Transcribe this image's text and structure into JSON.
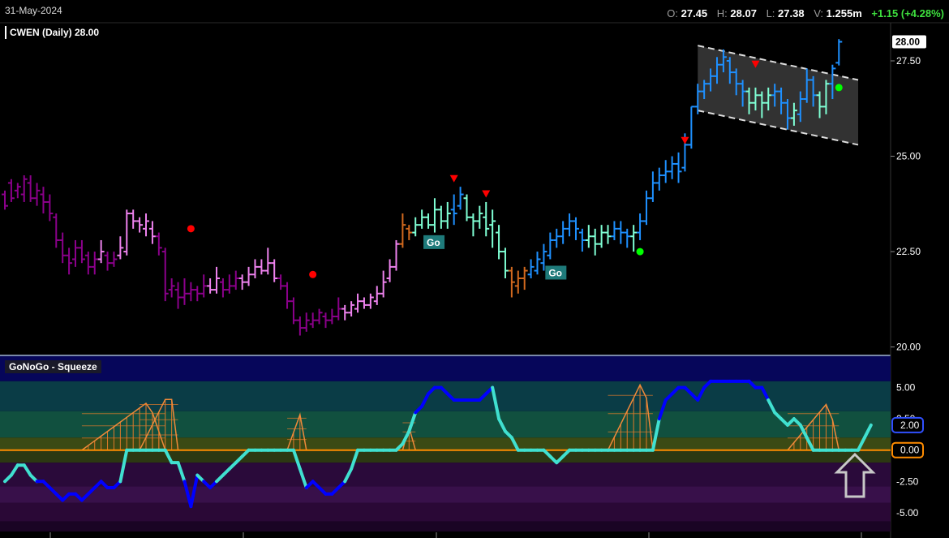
{
  "header": {
    "date": "31-May-2024",
    "open_key": "O:",
    "open": "27.45",
    "high_key": "H:",
    "high": "28.07",
    "low_key": "L:",
    "low": "27.38",
    "vol_key": "V:",
    "volume": "1.255m",
    "change": "+1.15 (+4.28%)"
  },
  "colors": {
    "background": "#000000",
    "go_strong": "#1e90ff",
    "go_weak": "#7fffd4",
    "nogo_strong": "#8b008b",
    "nogo_weak": "#ee82ee",
    "neutral": "#d2691e",
    "osc_low": "#0000ff",
    "osc_high": "#40e0d0",
    "zero_line": "#ff8c00",
    "up_marker": "#ff0000",
    "dn_marker": "#ff0000",
    "go_dot": "#00ff00",
    "nogo_dot": "#ff0000"
  },
  "chart_data": [
    {
      "type": "ohlc",
      "title": "CWEN (Daily) 28.00",
      "last_price_label": "28.00",
      "y_ticks": [
        "27.50",
        "25.00",
        "22.50",
        "20.00"
      ],
      "ylim": [
        19.8,
        28.5
      ],
      "channel_label": "",
      "go_labels": [
        "Go",
        "Go"
      ],
      "bars": [
        [
          0,
          24.0,
          23.7,
          24.1,
          23.6,
          "ns"
        ],
        [
          1,
          24.3,
          23.9,
          24.4,
          23.8,
          "ns"
        ],
        [
          2,
          24.1,
          24.2,
          24.3,
          23.9,
          "ns"
        ],
        [
          3,
          24.0,
          24.4,
          24.5,
          23.8,
          "ns"
        ],
        [
          4,
          24.3,
          23.9,
          24.5,
          23.8,
          "ns"
        ],
        [
          5,
          23.9,
          24.1,
          24.3,
          23.7,
          "ns"
        ],
        [
          6,
          24.0,
          23.8,
          24.2,
          23.5,
          "ns"
        ],
        [
          7,
          23.8,
          23.5,
          24.0,
          23.3,
          "ns"
        ],
        [
          8,
          23.4,
          22.8,
          23.5,
          22.6,
          "ns"
        ],
        [
          9,
          22.8,
          22.4,
          23.0,
          22.2,
          "ns"
        ],
        [
          10,
          22.4,
          22.2,
          22.6,
          21.9,
          "ns"
        ],
        [
          11,
          22.3,
          22.6,
          22.8,
          22.1,
          "ns"
        ],
        [
          12,
          22.6,
          22.3,
          22.8,
          22.2,
          "ns"
        ],
        [
          13,
          22.4,
          22.1,
          22.5,
          21.9,
          "ns"
        ],
        [
          14,
          22.1,
          22.3,
          22.5,
          21.9,
          "ns"
        ],
        [
          15,
          22.3,
          22.5,
          22.8,
          22.2,
          "nw"
        ],
        [
          16,
          22.4,
          22.2,
          22.5,
          22.0,
          "ns"
        ],
        [
          17,
          22.2,
          22.3,
          22.5,
          22.1,
          "ns"
        ],
        [
          18,
          22.4,
          22.6,
          22.9,
          22.3,
          "nw"
        ],
        [
          19,
          22.5,
          23.5,
          23.6,
          22.4,
          "nw"
        ],
        [
          20,
          23.5,
          23.3,
          23.6,
          23.1,
          "nw"
        ],
        [
          21,
          23.3,
          23.2,
          23.4,
          23.0,
          "nw"
        ],
        [
          22,
          23.1,
          23.3,
          23.5,
          22.9,
          "nw"
        ],
        [
          23,
          23.1,
          22.9,
          23.3,
          22.7,
          "nw"
        ],
        [
          24,
          22.9,
          22.6,
          23.0,
          22.4,
          "ns"
        ],
        [
          25,
          22.5,
          21.4,
          22.6,
          21.2,
          "ns"
        ],
        [
          26,
          21.5,
          21.6,
          21.8,
          21.3,
          "ns"
        ],
        [
          27,
          21.5,
          21.3,
          21.7,
          21.0,
          "ns"
        ],
        [
          28,
          21.3,
          21.4,
          21.8,
          21.1,
          "ns"
        ],
        [
          29,
          21.4,
          21.5,
          21.7,
          21.2,
          "ns"
        ],
        [
          30,
          21.5,
          21.4,
          21.6,
          21.2,
          "ns"
        ],
        [
          31,
          21.4,
          21.6,
          21.9,
          21.3,
          "ns"
        ],
        [
          32,
          21.6,
          21.5,
          21.8,
          21.4,
          "nw"
        ],
        [
          33,
          21.5,
          21.8,
          22.1,
          21.4,
          "nw"
        ],
        [
          34,
          21.7,
          21.5,
          21.8,
          21.3,
          "ns"
        ],
        [
          35,
          21.5,
          21.6,
          21.9,
          21.4,
          "ns"
        ],
        [
          36,
          21.6,
          21.8,
          22.0,
          21.5,
          "ns"
        ],
        [
          37,
          21.8,
          21.7,
          21.9,
          21.5,
          "nw"
        ],
        [
          38,
          21.7,
          21.9,
          22.1,
          21.6,
          "nw"
        ],
        [
          39,
          21.9,
          22.1,
          22.3,
          21.8,
          "nw"
        ],
        [
          40,
          22.1,
          22.0,
          22.3,
          21.9,
          "nw"
        ],
        [
          41,
          22.0,
          22.2,
          22.6,
          21.9,
          "nw"
        ],
        [
          42,
          22.2,
          21.8,
          22.3,
          21.7,
          "nw"
        ],
        [
          43,
          21.8,
          21.6,
          21.9,
          21.5,
          "ns"
        ],
        [
          44,
          21.6,
          21.2,
          21.7,
          21.0,
          "ns"
        ],
        [
          45,
          21.2,
          20.7,
          21.3,
          20.6,
          "ns"
        ],
        [
          46,
          20.7,
          20.5,
          20.8,
          20.3,
          "ns"
        ],
        [
          47,
          20.5,
          20.7,
          20.9,
          20.4,
          "ns"
        ],
        [
          48,
          20.6,
          20.7,
          20.9,
          20.5,
          "ns"
        ],
        [
          49,
          20.7,
          20.9,
          21.0,
          20.6,
          "ns"
        ],
        [
          50,
          20.8,
          20.7,
          20.9,
          20.5,
          "ns"
        ],
        [
          51,
          20.7,
          20.8,
          21.0,
          20.6,
          "ns"
        ],
        [
          52,
          20.8,
          21.0,
          21.3,
          20.7,
          "ns"
        ],
        [
          53,
          21.0,
          20.9,
          21.1,
          20.7,
          "nw"
        ],
        [
          54,
          20.9,
          21.1,
          21.2,
          20.8,
          "nw"
        ],
        [
          55,
          21.0,
          21.2,
          21.4,
          20.9,
          "nw"
        ],
        [
          56,
          21.2,
          21.1,
          21.3,
          21.0,
          "nw"
        ],
        [
          57,
          21.1,
          21.3,
          21.4,
          21.0,
          "nw"
        ],
        [
          58,
          21.2,
          21.4,
          21.6,
          21.1,
          "nw"
        ],
        [
          59,
          21.4,
          21.7,
          22.0,
          21.3,
          "nw"
        ],
        [
          60,
          21.8,
          22.1,
          22.3,
          21.7,
          "nw"
        ],
        [
          61,
          22.1,
          22.7,
          22.8,
          22.0,
          "nw"
        ],
        [
          62,
          22.7,
          23.2,
          23.5,
          22.6,
          "ne"
        ],
        [
          63,
          23.1,
          23.0,
          23.2,
          22.8,
          "ne"
        ],
        [
          64,
          23.0,
          23.2,
          23.4,
          22.9,
          "gw"
        ],
        [
          65,
          23.2,
          23.4,
          23.6,
          23.1,
          "gw"
        ],
        [
          66,
          23.4,
          23.2,
          23.5,
          23.1,
          "gw"
        ],
        [
          67,
          23.2,
          23.6,
          23.9,
          23.0,
          "gw"
        ],
        [
          68,
          23.6,
          23.3,
          23.7,
          23.1,
          "gw"
        ],
        [
          69,
          23.3,
          23.5,
          23.8,
          23.1,
          "gw"
        ],
        [
          70,
          23.6,
          23.5,
          24.0,
          23.2,
          "gs"
        ],
        [
          71,
          23.7,
          24.0,
          24.2,
          23.6,
          "gs"
        ],
        [
          72,
          23.9,
          23.4,
          24.0,
          23.3,
          "gw"
        ],
        [
          73,
          23.4,
          23.3,
          23.5,
          22.9,
          "gw"
        ],
        [
          74,
          23.3,
          23.5,
          23.7,
          23.1,
          "gw"
        ],
        [
          75,
          23.4,
          23.1,
          23.8,
          22.9,
          "gw"
        ],
        [
          76,
          23.2,
          23.3,
          23.6,
          22.6,
          "gw"
        ],
        [
          77,
          23.0,
          22.5,
          23.2,
          22.3,
          "gw"
        ],
        [
          78,
          22.5,
          22.0,
          22.6,
          21.8,
          "gw"
        ],
        [
          79,
          22.0,
          21.7,
          22.1,
          21.3,
          "ne"
        ],
        [
          80,
          21.6,
          21.8,
          22.0,
          21.4,
          "ne"
        ],
        [
          81,
          21.8,
          22.0,
          22.1,
          21.5,
          "ne"
        ],
        [
          82,
          21.9,
          22.1,
          22.3,
          21.8,
          "gs"
        ],
        [
          83,
          22.0,
          22.3,
          22.5,
          21.9,
          "gs"
        ],
        [
          84,
          22.2,
          22.5,
          22.7,
          22.0,
          "gs"
        ],
        [
          85,
          22.4,
          22.8,
          23.0,
          22.3,
          "gs"
        ],
        [
          86,
          22.8,
          22.9,
          23.1,
          22.6,
          "gs"
        ],
        [
          87,
          22.9,
          23.1,
          23.3,
          22.7,
          "gs"
        ],
        [
          88,
          23.1,
          23.3,
          23.5,
          22.9,
          "gs"
        ],
        [
          89,
          23.3,
          23.1,
          23.4,
          22.8,
          "gs"
        ],
        [
          90,
          23.0,
          22.8,
          23.1,
          22.5,
          "gs"
        ],
        [
          91,
          22.8,
          22.9,
          23.2,
          22.6,
          "gw"
        ],
        [
          92,
          22.9,
          22.7,
          23.1,
          22.4,
          "gw"
        ],
        [
          93,
          22.7,
          23.0,
          23.2,
          22.6,
          "gw"
        ],
        [
          94,
          23.0,
          22.9,
          23.2,
          22.7,
          "gw"
        ],
        [
          95,
          22.9,
          23.1,
          23.3,
          22.8,
          "gs"
        ],
        [
          96,
          23.1,
          23.0,
          23.3,
          22.7,
          "gs"
        ],
        [
          97,
          23.0,
          22.9,
          23.1,
          22.6,
          "gs"
        ],
        [
          98,
          22.9,
          23.0,
          23.2,
          22.5,
          "gw"
        ],
        [
          99,
          23.0,
          23.3,
          23.5,
          22.8,
          "gs"
        ],
        [
          100,
          23.3,
          23.9,
          24.1,
          23.2,
          "gs"
        ],
        [
          101,
          23.9,
          24.3,
          24.6,
          23.8,
          "gs"
        ],
        [
          102,
          24.3,
          24.5,
          24.7,
          24.1,
          "gs"
        ],
        [
          103,
          24.5,
          24.6,
          24.9,
          24.3,
          "gs"
        ],
        [
          104,
          24.6,
          24.8,
          25.0,
          24.4,
          "gs"
        ],
        [
          105,
          24.8,
          24.6,
          25.1,
          24.3,
          "gs"
        ],
        [
          106,
          24.7,
          25.3,
          25.6,
          24.6,
          "gs"
        ],
        [
          107,
          25.3,
          26.3,
          26.3,
          25.2,
          "gs"
        ],
        [
          108,
          26.3,
          26.7,
          26.9,
          26.1,
          "gs"
        ],
        [
          109,
          26.7,
          26.9,
          27.0,
          26.5,
          "gs"
        ],
        [
          110,
          26.9,
          27.1,
          27.3,
          26.7,
          "gs"
        ],
        [
          111,
          27.1,
          27.4,
          27.6,
          26.9,
          "gs"
        ],
        [
          112,
          27.4,
          27.6,
          27.8,
          27.2,
          "gs"
        ],
        [
          113,
          27.5,
          27.2,
          27.6,
          26.9,
          "gs"
        ],
        [
          114,
          27.2,
          26.9,
          27.3,
          26.6,
          "gs"
        ],
        [
          115,
          26.9,
          26.7,
          27.0,
          26.3,
          "gs"
        ],
        [
          116,
          26.7,
          26.4,
          26.8,
          26.1,
          "gw"
        ],
        [
          117,
          26.4,
          26.6,
          26.8,
          26.2,
          "gw"
        ],
        [
          118,
          26.6,
          26.4,
          26.7,
          26.0,
          "gw"
        ],
        [
          119,
          26.4,
          26.6,
          26.8,
          26.2,
          "gw"
        ],
        [
          120,
          26.6,
          26.7,
          26.9,
          26.3,
          "gs"
        ],
        [
          121,
          26.7,
          26.4,
          26.8,
          26.1,
          "gs"
        ],
        [
          122,
          26.4,
          26.0,
          26.5,
          25.7,
          "gs"
        ],
        [
          123,
          26.0,
          26.2,
          26.4,
          25.8,
          "gw"
        ],
        [
          124,
          26.1,
          26.5,
          26.7,
          25.9,
          "gs"
        ],
        [
          125,
          26.5,
          27.0,
          27.3,
          26.4,
          "gs"
        ],
        [
          126,
          27.0,
          26.6,
          27.1,
          26.3,
          "gs"
        ],
        [
          127,
          26.6,
          26.3,
          26.7,
          26.0,
          "gw"
        ],
        [
          128,
          26.3,
          26.9,
          27.0,
          26.1,
          "gw"
        ],
        [
          129,
          26.9,
          27.3,
          27.4,
          26.5,
          "gs"
        ],
        [
          130,
          27.45,
          28.0,
          28.07,
          27.38,
          "gs"
        ]
      ],
      "markers": [
        {
          "type": "nogo_dot",
          "bar": 29,
          "price": 23.1
        },
        {
          "type": "nogo_dot",
          "bar": 48,
          "price": 21.9
        },
        {
          "type": "dn_triangle",
          "bar": 70,
          "price": 24.4
        },
        {
          "type": "dn_triangle",
          "bar": 75,
          "price": 24.0
        },
        {
          "type": "go_dot",
          "bar": 99,
          "price": 22.5
        },
        {
          "type": "dn_triangle",
          "bar": 106,
          "price": 25.4
        },
        {
          "type": "dn_triangle",
          "bar": 117,
          "price": 27.4
        },
        {
          "type": "go_dot",
          "bar": 130,
          "price": 26.8
        }
      ],
      "go_label_bars": [
        66,
        85
      ],
      "channel": {
        "x_from": 108,
        "x_to": 133,
        "upper": [
          27.9,
          27.0
        ],
        "lower": [
          26.2,
          25.3
        ]
      }
    },
    {
      "type": "line",
      "title": "GoNoGo - Squeeze",
      "ylim": [
        -6.5,
        7.5
      ],
      "y_ticks": [
        "5.00",
        "2.50",
        "-2.50",
        "-5.00"
      ],
      "value_label_high": "2.00",
      "value_label_zero": "0.00",
      "values": [
        -2.5,
        -2.0,
        -1.2,
        -1.2,
        -2.0,
        -2.5,
        -2.5,
        -3.0,
        -3.5,
        -4.0,
        -3.5,
        -3.5,
        -4.0,
        -3.5,
        -3.0,
        -2.5,
        -3.0,
        -3.0,
        -2.5,
        0.0,
        0.0,
        0.0,
        0.0,
        0.0,
        0.0,
        0.0,
        -1.0,
        -1.0,
        -2.5,
        -4.5,
        -2.0,
        -2.5,
        -3.0,
        -2.5,
        -2.0,
        -1.5,
        -1.0,
        -0.5,
        0.0,
        0.0,
        0.0,
        0.0,
        0.0,
        0.0,
        0.0,
        0.0,
        -1.5,
        -3.0,
        -2.5,
        -3.0,
        -3.5,
        -3.5,
        -3.0,
        -2.5,
        -1.5,
        0.0,
        0.0,
        0.0,
        0.0,
        0.0,
        0.0,
        0.0,
        0.5,
        1.5,
        3.0,
        3.5,
        4.5,
        5.0,
        5.0,
        4.5,
        4.0,
        4.0,
        4.0,
        4.0,
        4.0,
        4.5,
        5.0,
        2.5,
        1.5,
        1.0,
        0.0,
        0.0,
        0.0,
        0.0,
        0.0,
        -0.5,
        -1.0,
        -0.5,
        0.0,
        0.0,
        0.0,
        0.0,
        0.0,
        0.0,
        0.0,
        0.0,
        0.0,
        0.0,
        0.0,
        0.0,
        0.0,
        0.0,
        2.5,
        4.0,
        4.5,
        5.0,
        5.0,
        4.5,
        4.0,
        5.0,
        5.5,
        5.5,
        5.5,
        5.5,
        5.5,
        5.5,
        5.5,
        5.0,
        5.0,
        4.0,
        3.0,
        2.5,
        2.0,
        2.5,
        2.0,
        1.0,
        0.0,
        0.0,
        0.0,
        0.0,
        0.0,
        0.0,
        0.0,
        0.0,
        1.0,
        2.0
      ],
      "squeeze_bars": [
        [
          12,
          25,
          40
        ],
        [
          21,
          27,
          50
        ],
        [
          44,
          47,
          35
        ],
        [
          62,
          64,
          30
        ],
        [
          94,
          101,
          60
        ],
        [
          122,
          130,
          40
        ]
      ]
    }
  ]
}
